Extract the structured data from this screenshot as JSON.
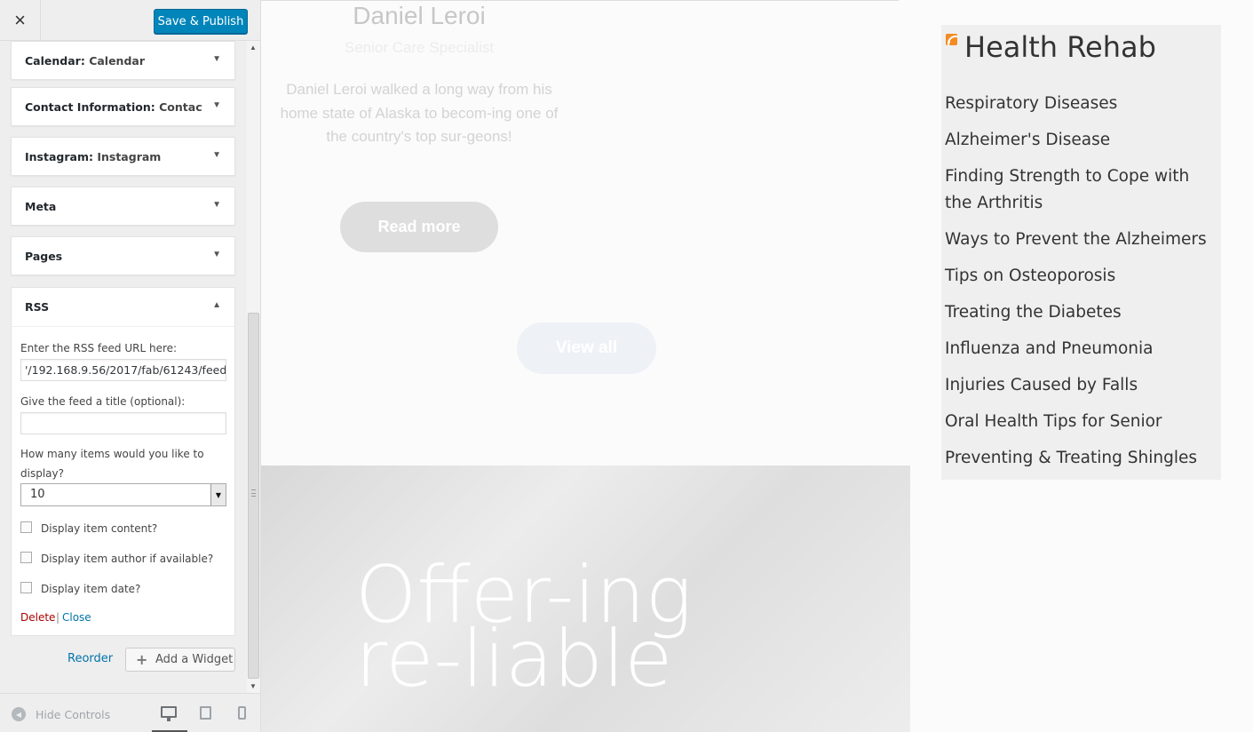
{
  "sidebar": {
    "close_icon": "×",
    "save_label": "Save & Publish",
    "widgets": [
      {
        "name": "Calendar",
        "sub": "Calendar"
      },
      {
        "name": "Contact Information",
        "sub": "Contact..."
      },
      {
        "name": "Instagram",
        "sub": "Instagram"
      },
      {
        "name": "Meta",
        "sub": ""
      },
      {
        "name": "Pages",
        "sub": ""
      }
    ],
    "rss": {
      "name": "RSS",
      "url_label": "Enter the RSS feed URL here:",
      "url_value": "'/192.168.9.56/2017/fab/61243/feed",
      "title_label": "Give the feed a title (optional):",
      "title_value": "",
      "count_label_1": "How many items would you like to",
      "count_label_2": "display?",
      "count_value": "10",
      "opt_content": "Display item content?",
      "opt_author": "Display item author if available?",
      "opt_date": "Display item date?",
      "delete_label": "Delete",
      "separator": "|",
      "close_label": "Close"
    },
    "reorder_label": "Reorder",
    "add_widget_label": "Add a Widget",
    "hide_controls_label": "Hide Controls"
  },
  "preview": {
    "person_name": "Daniel Leroi",
    "person_role": "Senior Care Specialist",
    "person_bio": "Daniel Leroi walked a long way from his home state of Alaska to becom-ing one of the country's top sur-geons!",
    "read_more_label": "Read more",
    "view_all_label": "View all",
    "hero_text": "Offer-ing re-liable",
    "rss_widget_title": "Health Rehab",
    "rss_items": [
      "Respiratory Diseases",
      "Alzheimer's Disease",
      "Finding Strength to Cope with the Arthritis",
      "Ways to Prevent the Alzheimers",
      "Tips on Osteoporosis",
      "Treating the Diabetes",
      "Influenza and Pneumonia",
      "Injuries Caused by Falls",
      "Oral Health Tips for Senior",
      "Preventing & Treating Shingles"
    ]
  },
  "colors": {
    "primary": "#0085ba",
    "link": "#0073aa",
    "delete": "#aa0000",
    "rss_orange": "#f48c23"
  },
  "icons": [
    "close-icon",
    "caret-down-icon",
    "caret-up-icon",
    "plus-icon",
    "hide-controls-icon",
    "desktop-icon",
    "tablet-icon",
    "mobile-icon",
    "rss-icon"
  ]
}
